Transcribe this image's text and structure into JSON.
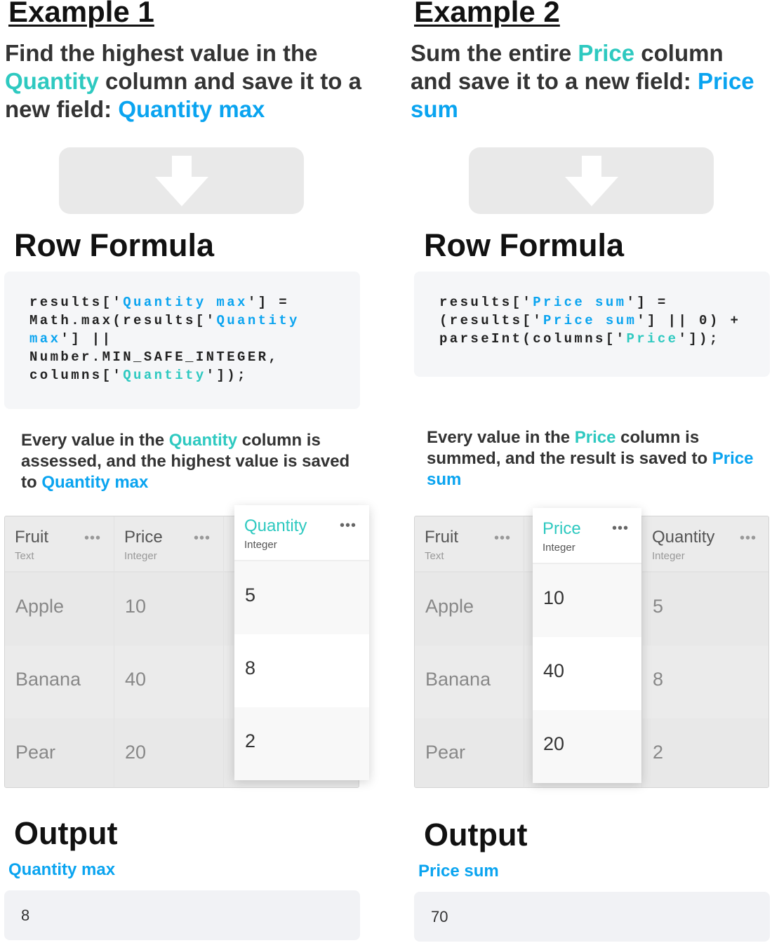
{
  "colors": {
    "column_ref": "#2ec9c0",
    "new_field": "#0aa4f0"
  },
  "examples": [
    {
      "title": "Example 1",
      "task": [
        {
          "t": "Find the highest value in the "
        },
        {
          "t": "Quantity",
          "c": "col"
        },
        {
          "t": " column and save it to a new field: "
        },
        {
          "t": "Quantity max",
          "c": "new"
        }
      ],
      "arrow_icon": "arrow-down-icon",
      "formula_heading": "Row Formula",
      "code": [
        [
          {
            "t": "results['"
          },
          {
            "t": "Quantity max",
            "c": "new"
          },
          {
            "t": "'] ="
          }
        ],
        [
          {
            "t": "Math.max(results['"
          },
          {
            "t": "Quantity",
            "c": "new"
          }
        ],
        [
          {
            "t": "max",
            "c": "new"
          },
          {
            "t": "'] ||"
          }
        ],
        [
          {
            "t": "Number.MIN_SAFE_INTEGER,"
          }
        ],
        [
          {
            "t": "columns['"
          },
          {
            "t": "Quantity",
            "c": "col"
          },
          {
            "t": "']);"
          }
        ]
      ],
      "description": [
        {
          "t": "Every value in the "
        },
        {
          "t": "Quantity",
          "c": "col"
        },
        {
          "t": " column is assessed, and the highest value is saved to "
        },
        {
          "t": "Quantity max",
          "c": "new"
        }
      ],
      "table": {
        "highlight": 2,
        "columns": [
          {
            "name": "Fruit",
            "type": "Text",
            "cells": [
              "Apple",
              "Banana",
              "Pear"
            ]
          },
          {
            "name": "Price",
            "type": "Integer",
            "cells": [
              "10",
              "40",
              "20"
            ]
          },
          {
            "name": "Quantity",
            "type": "Integer",
            "cells": [
              "5",
              "8",
              "2"
            ]
          }
        ]
      },
      "output_heading": "Output",
      "output_label": "Quantity max",
      "output_value": "8"
    },
    {
      "title": "Example 2",
      "task": [
        {
          "t": "Sum the entire "
        },
        {
          "t": "Price",
          "c": "col"
        },
        {
          "t": " column and save it to a new field: "
        },
        {
          "t": "Price sum",
          "c": "new"
        }
      ],
      "arrow_icon": "arrow-down-icon",
      "formula_heading": "Row Formula",
      "code": [
        [
          {
            "t": "results['"
          },
          {
            "t": "Price sum",
            "c": "new"
          },
          {
            "t": "'] ="
          }
        ],
        [
          {
            "t": "(results['"
          },
          {
            "t": "Price sum",
            "c": "new"
          },
          {
            "t": "'] || 0) +"
          }
        ],
        [
          {
            "t": "parseInt(columns['"
          },
          {
            "t": "Price",
            "c": "col"
          },
          {
            "t": "']);"
          }
        ]
      ],
      "description": [
        {
          "t": "Every value in the "
        },
        {
          "t": "Price",
          "c": "col"
        },
        {
          "t": " column is summed, and the result is saved to "
        },
        {
          "t": "Price sum",
          "c": "new"
        }
      ],
      "table": {
        "highlight": 1,
        "columns": [
          {
            "name": "Fruit",
            "type": "Text",
            "cells": [
              "Apple",
              "Banana",
              "Pear"
            ]
          },
          {
            "name": "Price",
            "type": "Integer",
            "cells": [
              "10",
              "40",
              "20"
            ]
          },
          {
            "name": "Quantity",
            "type": "Integer",
            "cells": [
              "5",
              "8",
              "2"
            ]
          }
        ]
      },
      "output_heading": "Output",
      "output_label": "Price sum",
      "output_value": "70"
    }
  ]
}
